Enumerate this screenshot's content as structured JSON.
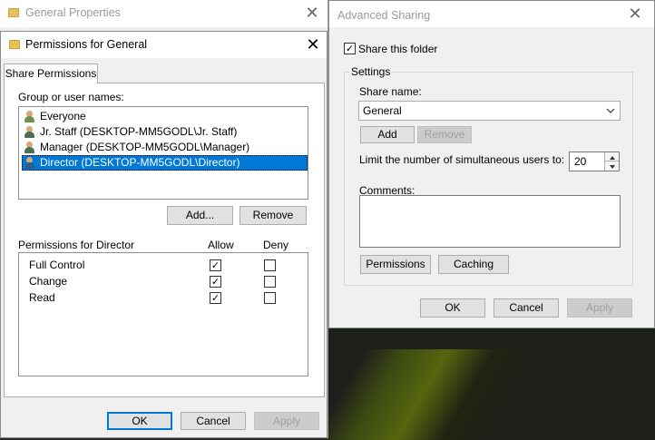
{
  "background_window": {
    "title": "General Properties"
  },
  "permissions_dialog": {
    "title": "Permissions for General",
    "tab": "Share Permissions",
    "group_label": "Group or user names:",
    "users": [
      {
        "name": "Everyone",
        "icon": "group-users-icon",
        "selected": false
      },
      {
        "name": "Jr. Staff (DESKTOP-MM5GODL\\Jr. Staff)",
        "icon": "user-icon",
        "selected": false
      },
      {
        "name": "Manager (DESKTOP-MM5GODL\\Manager)",
        "icon": "user-icon",
        "selected": false
      },
      {
        "name": "Director (DESKTOP-MM5GODL\\Director)",
        "icon": "user-icon",
        "selected": true
      }
    ],
    "add_label": "Add...",
    "remove_label": "Remove",
    "perms_label": "Permissions for Director",
    "allow_label": "Allow",
    "deny_label": "Deny",
    "permissions": [
      {
        "name": "Full Control",
        "allow": true,
        "deny": false
      },
      {
        "name": "Change",
        "allow": true,
        "deny": false
      },
      {
        "name": "Read",
        "allow": true,
        "deny": false
      }
    ],
    "ok_label": "OK",
    "cancel_label": "Cancel",
    "apply_label": "Apply"
  },
  "advanced_sharing": {
    "title": "Advanced Sharing",
    "share_checkbox_label": "Share this folder",
    "share_checked": true,
    "settings_label": "Settings",
    "share_name_label": "Share name:",
    "share_name_value": "General",
    "add_label": "Add",
    "remove_label": "Remove",
    "limit_label": "Limit the number of simultaneous users to:",
    "limit_value": "20",
    "comments_label": "Comments:",
    "comments_value": "",
    "permissions_label": "Permissions",
    "caching_label": "Caching",
    "ok_label": "OK",
    "cancel_label": "Cancel",
    "apply_label": "Apply"
  },
  "close_glyph": "✕",
  "check_glyph": "✓",
  "colors": {
    "selection": "#0078d7",
    "focus": "#0078d7"
  }
}
